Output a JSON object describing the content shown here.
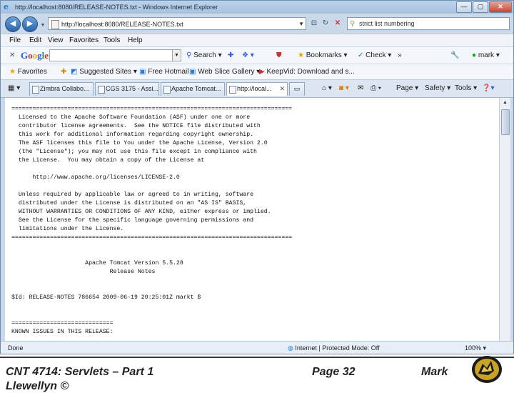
{
  "window": {
    "title": "http://localhost:8080/RELEASE-NOTES.txt - Windows Internet Explorer",
    "controls": {
      "minimize": "—",
      "maximize": "▢",
      "close": "✕"
    }
  },
  "address_bar": {
    "url": "http://localhost:8080/RELEASE-NOTES.txt",
    "search_value": "strict list numbering"
  },
  "menu": [
    "File",
    "Edit",
    "View",
    "Favorites",
    "Tools",
    "Help"
  ],
  "google_toolbar": {
    "logo": "Google",
    "items": [
      "Search",
      "Bookmarks",
      "Check",
      "»",
      "mark"
    ]
  },
  "favorites_bar": {
    "favorites_label": "Favorites",
    "items": [
      "Suggested Sites",
      "Free Hotmail",
      "Web Slice Gallery",
      "KeepVid: Download and s..."
    ]
  },
  "tabs": [
    {
      "label": "Zimbra Collabo...",
      "active": false
    },
    {
      "label": "CGS 3175 - Assi...",
      "active": false
    },
    {
      "label": "Apache Tomcat...",
      "active": false
    },
    {
      "label": "http://local...",
      "active": true
    }
  ],
  "command_bar": [
    "Page",
    "Safety",
    "Tools"
  ],
  "document": {
    "text": "================================================================================\n  Licensed to the Apache Software Foundation (ASF) under one or more\n  contributor license agreements.  See the NOTICE file distributed with\n  this work for additional information regarding copyright ownership.\n  The ASF licenses this file to You under the Apache License, Version 2.0\n  (the \"License\"); you may not use this file except in compliance with\n  the License.  You may obtain a copy of the License at\n\n      http://www.apache.org/licenses/LICENSE-2.0\n\n  Unless required by applicable law or agreed to in writing, software\n  distributed under the License is distributed on an \"AS IS\" BASIS,\n  WITHOUT WARRANTIES OR CONDITIONS OF ANY KIND, either express or implied.\n  See the License for the specific language governing permissions and\n  limitations under the License.\n================================================================================\n\n\n                     Apache Tomcat Version 5.5.28\n                            Release Notes\n\n\n$Id: RELEASE-NOTES 786654 2009-06-19 20:25:01Z markt $\n\n\n=============================\nKNOWN ISSUES IN THIS RELEASE:"
  },
  "status_bar": {
    "done": "Done",
    "zone": "Internet | Protected Mode: Off",
    "zoom": "100%"
  },
  "slide_footer": {
    "course": "CNT 4714: Servlets – Part 1",
    "page": "Page 32",
    "author_first": "Mark",
    "author_last": "Llewellyn ©"
  }
}
